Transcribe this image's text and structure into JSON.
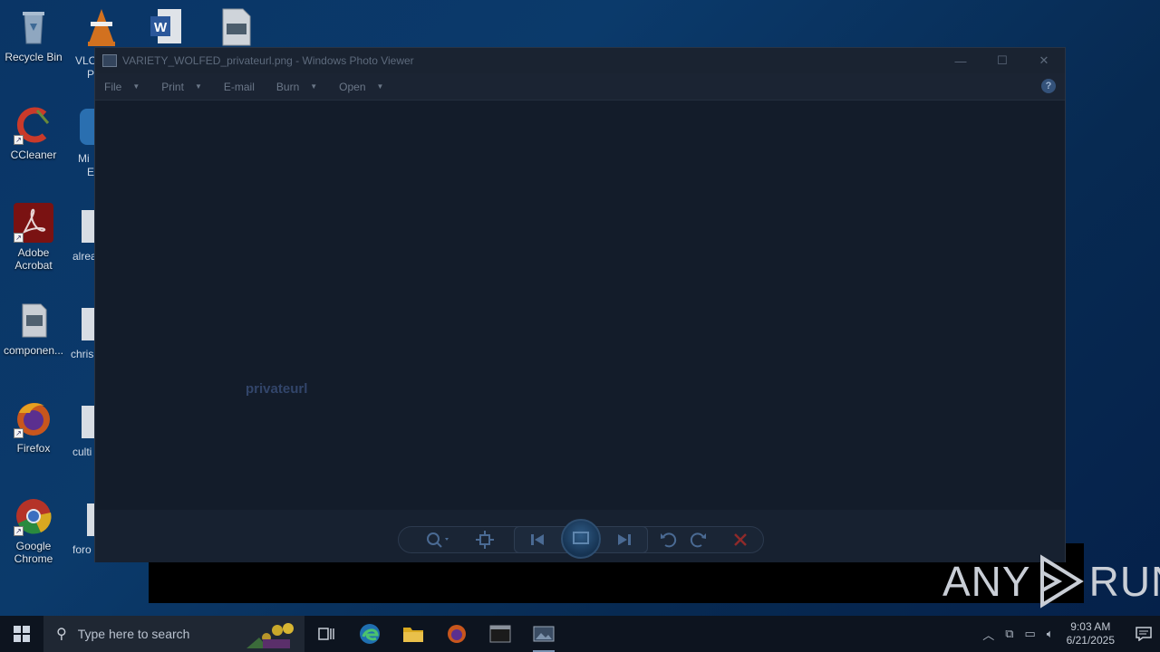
{
  "desktop": {
    "icons": [
      {
        "label": "Recycle Bin"
      },
      {
        "label": "CCleaner"
      },
      {
        "label": "Adobe Acrobat"
      },
      {
        "label": "componen..."
      },
      {
        "label": "Firefox"
      },
      {
        "label": "Google Chrome"
      }
    ],
    "partial_labels": [
      "VLC",
      "P",
      "Mi",
      "E",
      "alrea",
      "chris",
      "culti",
      "foro"
    ]
  },
  "window": {
    "title": "VARIETY_WOLFED_privateurl.png - Windows Photo Viewer",
    "menu": [
      {
        "label": "File"
      },
      {
        "label": "Print"
      },
      {
        "label": "E-mail"
      },
      {
        "label": "Burn"
      },
      {
        "label": "Open"
      }
    ],
    "help": "?",
    "image_text": "privateurl"
  },
  "watermark": {
    "left": "ANY",
    "right": "RUN"
  },
  "taskbar": {
    "search_placeholder": "Type here to search",
    "time": "9:03 AM",
    "date": "6/21/2025"
  },
  "colors": {
    "accent": "#0078d7",
    "window_bg": "#131c2a",
    "close_red": "#a83232"
  }
}
